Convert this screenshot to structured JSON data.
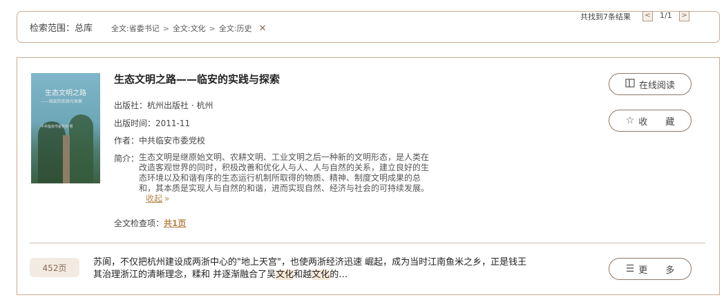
{
  "filter": {
    "scope_label": "检索范围：",
    "scope_value": "总库",
    "crumbs": [
      "全文:省委书记",
      "全文:文化",
      "全文:历史"
    ],
    "separator": ">",
    "clear_glyph": "✕",
    "result_count": "共找到7条结果",
    "page": "1/1",
    "prev_glyph": "<",
    "next_glyph": ">"
  },
  "book": {
    "title": "生态文明之路——临安的实践与探索",
    "publisher_label": "出版社：",
    "publisher": "杭州出版社 · 杭州",
    "date_label": "出版时间：",
    "date": "2011-11",
    "author_label": "作者：",
    "author": "中共临安市委党校",
    "intro_label": "简介：",
    "intro": "生态文明是继原始文明、农耕文明、工业文明之后一种新的文明形态，是人类在改造客观世界的同时，积极改善和优化人与人、人与自然的关系，建立良好的生态环境以及和谐有序的生态运行机制所取得的物质、精神、制度文明成果的总和，其本质是实现人与自然的和谐，进而实现自然、经济与社会的可持续发展。",
    "collapse_label": "收起",
    "fulltext_label": "全文检查项：",
    "fulltext_hits": "共1页",
    "cover": {
      "title": "生态文明之路",
      "subtitle": "——临安的实践与探索",
      "publisher": "中共临安市委党校 著"
    }
  },
  "actions": {
    "read_label": "在线阅读",
    "fav_label": "收　　藏",
    "more_label": "更　　多"
  },
  "hit": {
    "page_badge": "452页",
    "snippet_before": "苏阆，不仅把杭州建设成两浙中心的\"地上天宫\"，也使两浙经济迅速 崛起，成为当时江南鱼米之乡，正是钱王其治理浙江的清晰理念，糅和 并逐渐融合了吴",
    "snippet_hl1": "文化",
    "snippet_mid": "和越",
    "snippet_hl2": "文化",
    "snippet_after": "的…"
  }
}
